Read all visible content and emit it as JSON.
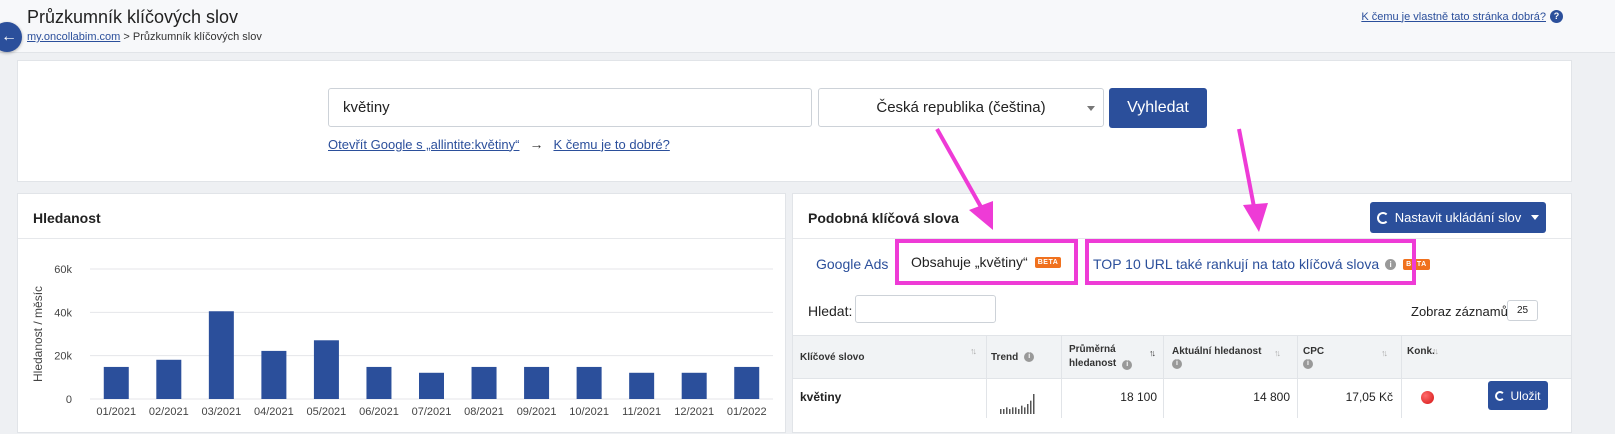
{
  "header": {
    "title": "Průzkumník klíčových slov",
    "breadcrumb_home": "my.oncollabim.com",
    "breadcrumb_rest": " > Průzkumník klíčových slov",
    "help_link": "K čemu je vlastně tato stránka dobrá?",
    "back_icon": "←",
    "help_icon": "?"
  },
  "search": {
    "keyword_value": "květiny",
    "country_value": "Česká republika (čeština)",
    "search_button": "Vyhledat",
    "google_link": "Otevřít Google s „allintite:květiny“",
    "arrow": "→",
    "why_link": "K čemu je to dobré?"
  },
  "volume_card": {
    "title": "Hledanost"
  },
  "chart_data": {
    "type": "bar",
    "ylabel": "Hledanost / měsíc",
    "ylim": [
      0,
      60000
    ],
    "yticks": [
      0,
      20000,
      40000,
      60000
    ],
    "ytick_labels": [
      "0",
      "20k",
      "40k",
      "60k"
    ],
    "categories": [
      "01/2021",
      "02/2021",
      "03/2021",
      "04/2021",
      "05/2021",
      "06/2021",
      "07/2021",
      "08/2021",
      "09/2021",
      "10/2021",
      "11/2021",
      "12/2021",
      "01/2022"
    ],
    "values": [
      14800,
      18100,
      40500,
      22200,
      27100,
      14800,
      12100,
      14800,
      14800,
      14800,
      12100,
      12100,
      14800
    ],
    "bar_color": "#2b4f9b",
    "grid": true
  },
  "similar_card": {
    "title": "Podobná klíčová slova",
    "save_settings_button": "Nastavit ukládání slov",
    "tabs": [
      {
        "label": "Google Ads"
      },
      {
        "label": "Obsahuje „květiny“",
        "badge": "BETA"
      },
      {
        "label": "TOP 10 URL také rankují na tato klíčová slova",
        "badge": "BETA"
      }
    ],
    "info_icon": "i",
    "filter_label": "Hledat:",
    "rows_label": "Zobraz záznamů",
    "rows_value": "25",
    "columns": [
      "Klíčové slovo",
      "Trend",
      "Průměrná",
      "hledanost",
      "Aktuální hledanost",
      "CPC",
      "Konk."
    ],
    "rows": [
      {
        "keyword": "květiny",
        "avg": "18 100",
        "current": "14 800",
        "cpc": "17,05 Kč",
        "save": "Uložit",
        "trend": [
          3,
          3,
          4,
          3,
          4,
          4,
          3,
          5,
          4,
          6,
          8,
          12
        ]
      }
    ]
  },
  "colors": {
    "accent": "#2b4f9b",
    "highlight": "#ee3bd6",
    "badge": "#f0711e"
  }
}
